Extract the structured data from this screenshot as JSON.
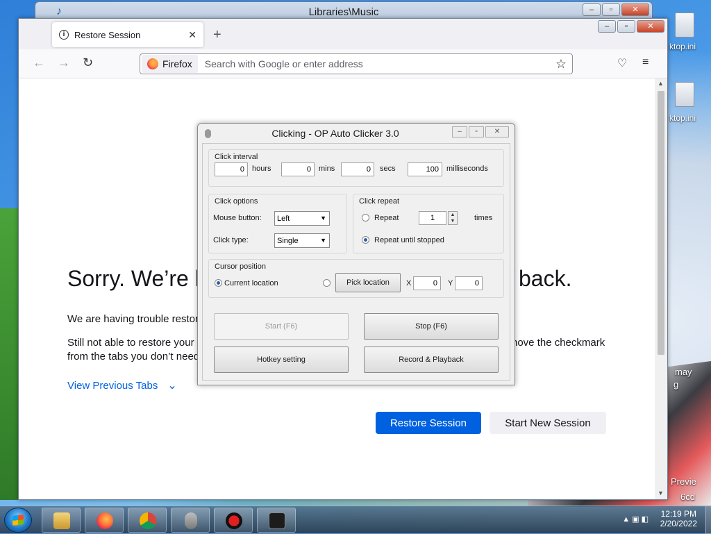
{
  "desktop": {
    "icon_labels": [
      "ktop.ini",
      "ktop.ini"
    ],
    "partial_text_1": "may",
    "partial_text_2": "g",
    "partial_text_3": "Previe",
    "partial_text_4": "6cd"
  },
  "bg_window": {
    "title": "Libraries\\Music"
  },
  "firefox": {
    "tab_title": "Restore Session",
    "url_badge": "Firefox",
    "url_placeholder": "Search with Google or enter address",
    "heading_start": "Sorry. We’re h",
    "heading_end": "back.",
    "para1": "We are having trouble restor",
    "para2_start": "Still not able to restore your",
    "para2_end": "nove the checkmark",
    "para3": "from the tabs you don’t need",
    "view_tabs": "View Previous Tabs",
    "restore_button": "Restore Session",
    "new_session_button": "Start New Session"
  },
  "clicker": {
    "title": "Clicking - OP Auto Clicker 3.0",
    "interval": {
      "label": "Click interval",
      "hours_value": "0",
      "hours_label": "hours",
      "mins_value": "0",
      "mins_label": "mins",
      "secs_value": "0",
      "secs_label": "secs",
      "ms_value": "100",
      "ms_label": "milliseconds"
    },
    "options": {
      "label": "Click options",
      "mouse_button_label": "Mouse button:",
      "mouse_button_value": "Left",
      "click_type_label": "Click type:",
      "click_type_value": "Single"
    },
    "repeat": {
      "label": "Click repeat",
      "repeat_label": "Repeat",
      "repeat_value": "1",
      "times_label": "times",
      "until_stopped_label": "Repeat until stopped"
    },
    "cursor": {
      "label": "Cursor position",
      "current_label": "Current location",
      "pick_button": "Pick location",
      "x_label": "X",
      "x_value": "0",
      "y_label": "Y",
      "y_value": "0"
    },
    "buttons": {
      "start": "Start (F6)",
      "stop": "Stop (F6)",
      "hotkey": "Hotkey setting",
      "record": "Record & Playback"
    }
  },
  "taskbar": {
    "time": "12:19 PM",
    "date": "2/20/2022"
  },
  "colors": {
    "firefox_accent": "#0061e0",
    "link": "#0061e0"
  }
}
